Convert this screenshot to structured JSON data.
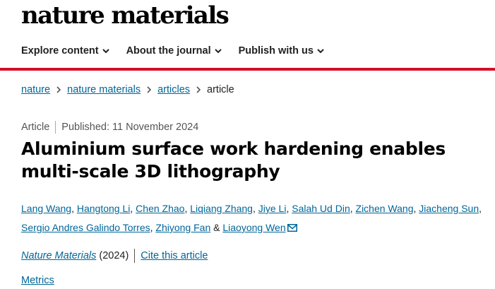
{
  "header": {
    "logo_text": "nature materials",
    "nav": [
      {
        "label": "Explore content"
      },
      {
        "label": "About the journal"
      },
      {
        "label": "Publish with us"
      }
    ],
    "accent_color": "#d40d27"
  },
  "breadcrumb": {
    "items": [
      "nature",
      "nature materials",
      "articles"
    ],
    "current": "article"
  },
  "article": {
    "type": "Article",
    "published": "Published: 11 November 2024",
    "title": "Aluminium surface work hardening enables multi-scale 3D lithography",
    "authors": [
      "Lang Wang",
      "Hangtong Li",
      "Chen Zhao",
      "Liqiang Zhang",
      "Jiye Li",
      "Salah Ud Din",
      "Zichen Wang",
      "Jiacheng Sun",
      "Sergio Andres Galindo Torres",
      "Zhiyong Fan",
      "Liaoyong Wen"
    ],
    "author_separator": ", ",
    "author_conjunction": " & ",
    "corresponding_icon": "mail-icon",
    "journal": "Nature Materials",
    "year": "(2024)",
    "cite_label": "Cite this article",
    "metrics_label": "Metrics"
  },
  "colors": {
    "link": "#006699",
    "text": "#222222"
  }
}
